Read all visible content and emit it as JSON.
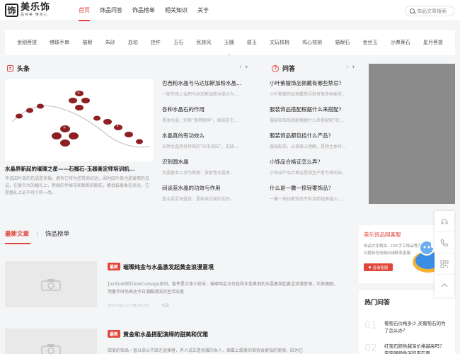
{
  "header": {
    "logo_mark": "饰",
    "logo_name": "美乐饰",
    "logo_tag": "品味美  懂身心",
    "nav": [
      "首页",
      "饰品问答",
      "饰品榜单",
      "相关知识",
      "关于"
    ],
    "search_placeholder": "饰品文章搜索"
  },
  "categories": [
    "金刚菩提",
    "佛珠手串",
    "猫眼",
    "朱砂",
    "血珀",
    "挂件",
    "玉石",
    "民族风",
    "玉髓",
    "碧玉",
    "文玩核桃",
    "鸡心核桃",
    "猫眼石",
    "金丝玉",
    "沙弗莱石",
    "星月菩提"
  ],
  "headlines": {
    "title": "头条",
    "feature_title": "水晶界新起的璀璨之星——石榴石-玉器鉴定师培训机...",
    "feature_desc": "传说四叶草的花语是幸福，拥有它将为您带来好运，因为四叶草也是爱情的见证。在爱尔兰的婚礼上，新娘的手捧花和新郎的胸花，都会装着象征幸运，它是婚礼上必不可少的一品。",
    "articles": [
      {
        "title": "巴西粉水晶与马达加斯加粉水晶...",
        "desc": "一般市场上会把马达加斯加粉水晶分为..."
      },
      {
        "title": "各种水晶石的作用",
        "desc": "黑发水晶：别称\"鬼佬财神\"，原因是它..."
      },
      {
        "title": "水晶真的有功效么",
        "desc": "天然水晶具有特殊的\"压电效应\"，无缺..."
      },
      {
        "title": "识别圆水晶",
        "desc": "水晶基本上分为两类：放射性水晶发..."
      },
      {
        "title": "间谈蓝水晶的功效与作用",
        "desc": "蓝水晶呈海蓝色，是相当优美的宝石..."
      }
    ]
  },
  "qa": {
    "title": "问答",
    "items": [
      {
        "title": "小叶紫檀饰品佩戴有哪些禁忌?",
        "desc": "小叶紫檀饰品佩戴禁忌就有很多种类型..."
      },
      {
        "title": "服装饰品搭配根据什么来搭配?",
        "desc": "服装和饰品搭配根据什么来搭配呢?在..."
      },
      {
        "title": "服装饰品都包括什么产品?",
        "desc": "服装配饰，从表面上理解，是除主体衬..."
      },
      {
        "title": "小饰品合格证怎么弄?",
        "desc": "小饰品产品合格证是指生产者为表明出..."
      },
      {
        "title": "什么是一撇一捺轻奢饰品?",
        "desc": "一撇一捺轻奢饰品专柜目前越来越火，..."
      }
    ]
  },
  "latest": {
    "tabs": [
      "最新文章",
      "饰品榜单"
    ],
    "posts": [
      {
        "tag": "最新",
        "title": "璀璨纯金与水晶激发起黄金浪漫意境",
        "desc": "JustGold的GlamCorsage系列，套件是立体小花朵，璀璨纯金与白色和灰色奥地利水晶激发起黄金浪漫意境，华美瑰丽，用奢华时尚表达今日潮酷潮流的生活态度",
        "date": "2023-02-27 00:24:30",
        "category": "水晶"
      },
      {
        "tag": "最新",
        "title": "黄金和水晶搭配演绎的甜美和优雅",
        "desc": "甜美的饰品一直以来从不缺乏追捧者，有人说正是优雅的女人，佩戴上甜美的首饰会更加的美丽，因为它"
      }
    ]
  },
  "service": {
    "title": "美乐饰品网客服",
    "desc": "饰品文化相关、DIY手工饰品等方面问题有任何疑问请联系客服",
    "button": "咨询客服"
  },
  "hot": {
    "title": "热门问答",
    "items": [
      {
        "num": "01",
        "text": "葡萄石价格多少,买葡萄石的为了怎么办?"
      },
      {
        "num": "02",
        "text": "红宝石颜色越深价格越高吗? 宝宝强颜色深的宝石更..."
      }
    ]
  },
  "pager": {
    "prev": "‹",
    "next": "›"
  },
  "colors": {
    "accent": "#e0463a",
    "ad_gray": "#8b8b8b"
  }
}
